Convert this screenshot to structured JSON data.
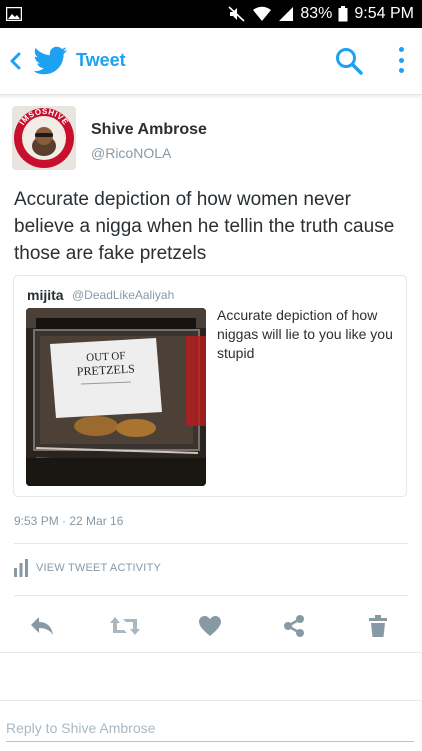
{
  "status_bar": {
    "battery": "83%",
    "time": "9:54 PM",
    "icons": [
      "gallery-icon",
      "mute-icon",
      "wifi-icon",
      "signal-icon",
      "battery-icon"
    ]
  },
  "app_bar": {
    "title": "Tweet",
    "accent_color": "#1da1f2",
    "icons": [
      "back-arrow-icon",
      "twitter-bird-icon",
      "search-icon",
      "more-icon"
    ]
  },
  "tweet": {
    "author_name": "Shive Ambrose",
    "author_handle": "@RicoNOLA",
    "avatar_badge_text": "IMSOSHIVE",
    "text": "Accurate depiction of how women never believe a nigga when he tellin the truth cause those are fake pretzels",
    "timestamp": "9:53 PM · 22 Mar 16",
    "activity_label": "VIEW TWEET ACTIVITY"
  },
  "quoted_tweet": {
    "author_name": "mijita",
    "author_handle": "@DeadLikeAaliyah",
    "text": "Accurate depiction of how niggas will lie to you like you stupid",
    "image_sign_line1": "OUT OF",
    "image_sign_line2": "PRETZELS"
  },
  "actions": [
    "reply-icon",
    "retweet-icon",
    "like-icon",
    "share-icon",
    "delete-icon"
  ],
  "reply": {
    "placeholder": "Reply to Shive Ambrose"
  }
}
